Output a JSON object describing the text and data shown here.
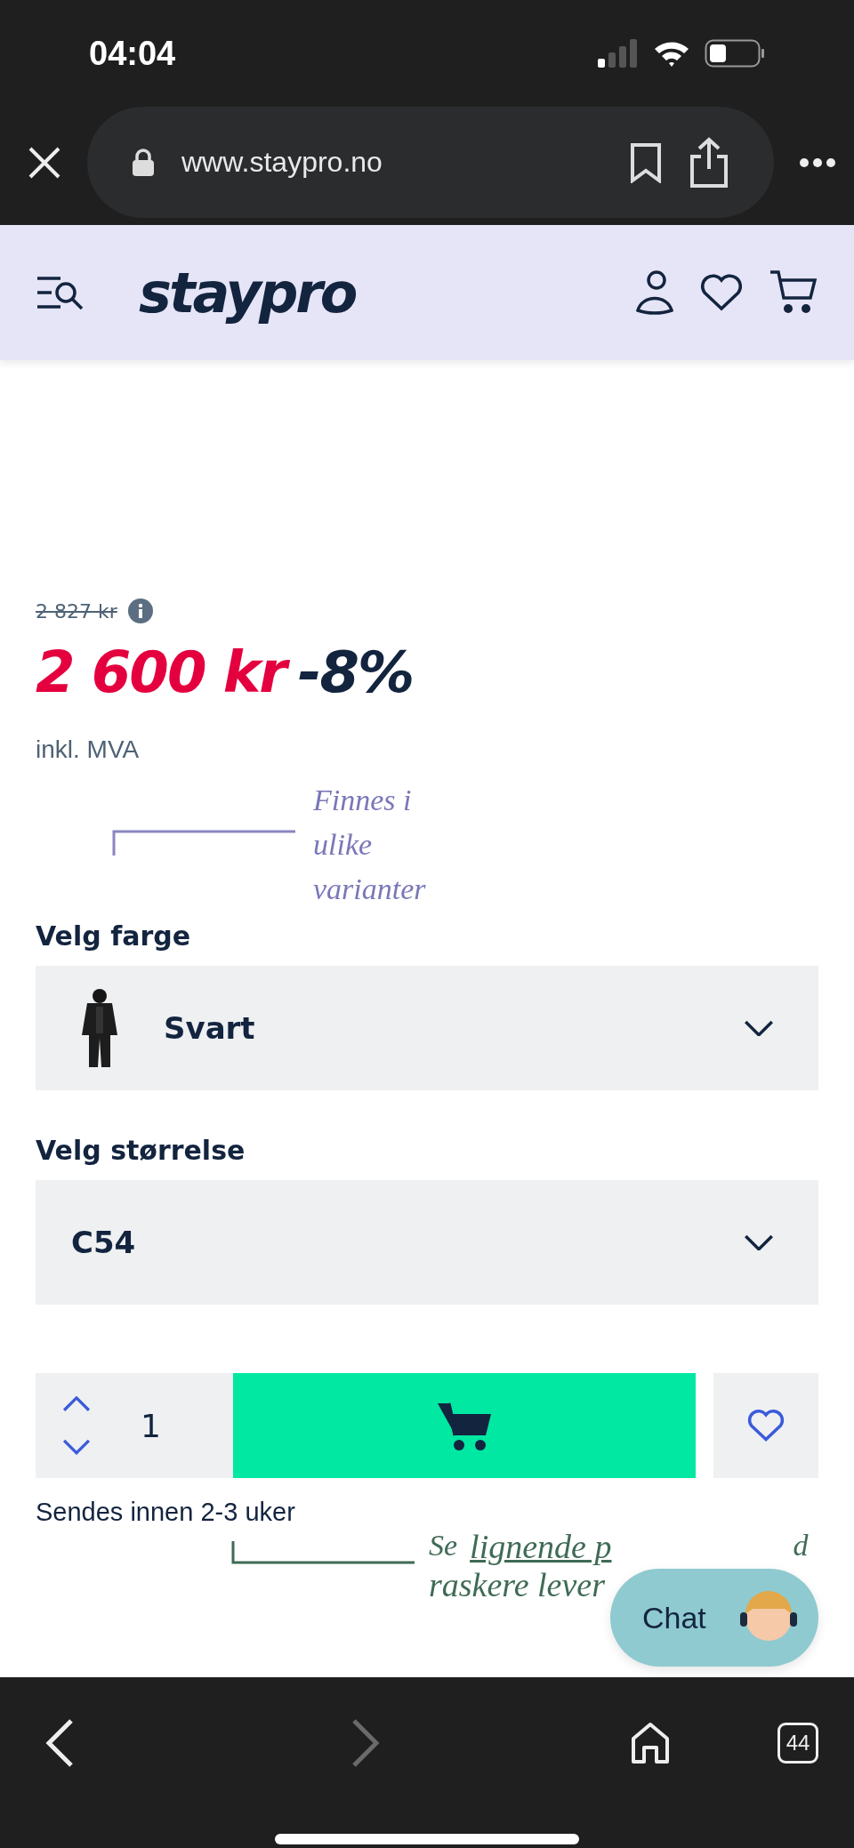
{
  "status_bar": {
    "time": "04:04"
  },
  "browser": {
    "url": "www.staypro.no",
    "tabs_count": "44",
    "forward_disabled": true
  },
  "site_header": {
    "logo": "staypro"
  },
  "product": {
    "old_price": "2 827 kr",
    "price": "2 600 kr",
    "discount": "-8%",
    "vat_note": "inkl. MVA",
    "variants_note": "Finnes i ulike varianter",
    "options": [
      {
        "label": "Velg farge",
        "value": "Svart",
        "kind": "thumbnail"
      },
      {
        "label": "Velg størrelse",
        "value": "C54",
        "kind": "plain"
      }
    ],
    "quantity": "1",
    "delivery": "Sendes innen 2-3 uker",
    "similar_note": {
      "prefix": "Se",
      "link": "lignende p",
      "suffix": "d",
      "line_2": "raskere lever"
    }
  },
  "chat": {
    "label": "Chat"
  }
}
